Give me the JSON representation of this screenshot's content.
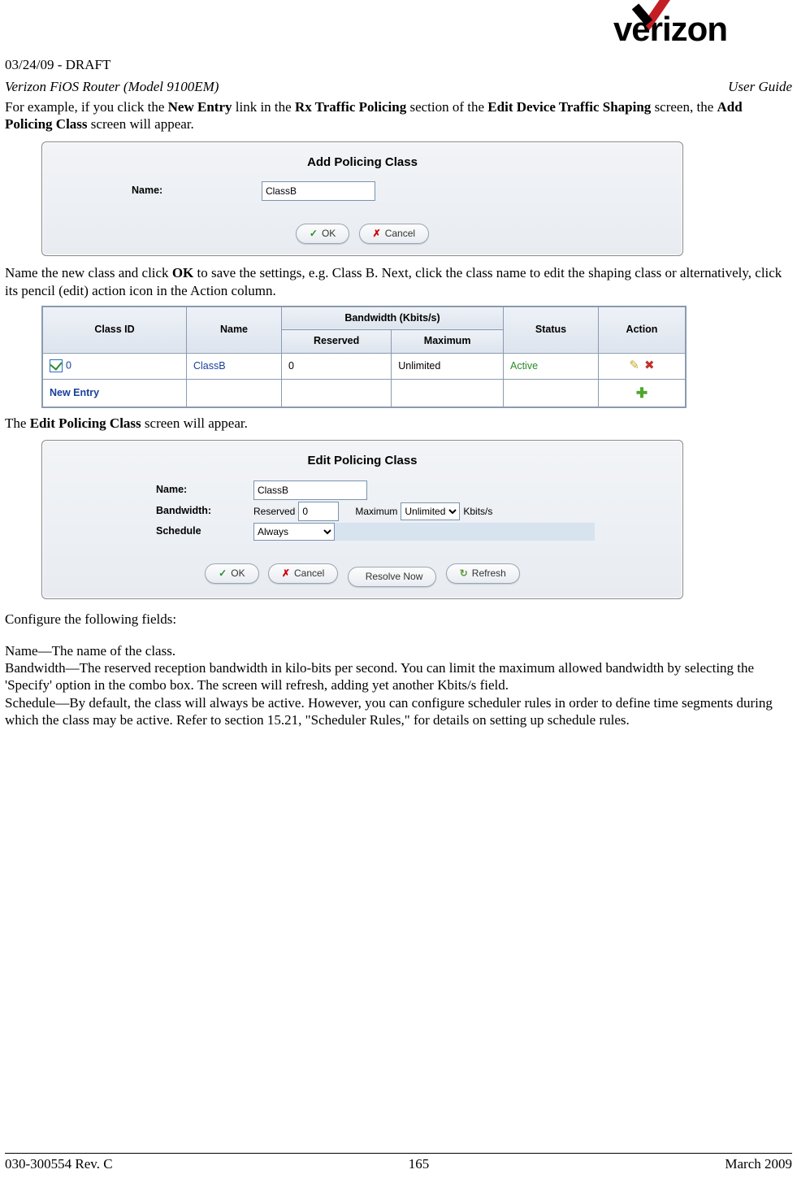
{
  "header": {
    "logo_text": "verizon",
    "draft_line": "03/24/09 - DRAFT",
    "product": "Verizon FiOS Router (Model 9100EM)",
    "doc_type": "User Guide"
  },
  "para1": {
    "pre": "For example, if you click the ",
    "b1": "New Entry",
    "m1": " link in the ",
    "b2": "Rx Traffic Policing",
    "m2": " section of the ",
    "b3": "Edit Device Traffic Shaping",
    "m3": " screen, the ",
    "b4": "Add Policing Class",
    "post": " screen will appear."
  },
  "add_panel": {
    "title": "Add Policing Class",
    "name_label": "Name:",
    "name_value": "ClassB",
    "ok": "OK",
    "cancel": "Cancel"
  },
  "para2": {
    "pre": "Name the new class and click ",
    "b1": "OK",
    "post": " to save the settings, e.g. Class B. Next, click the class name to edit the shaping class or alternatively, click its pencil (edit) action icon in the Action column."
  },
  "table": {
    "h_classid": "Class ID",
    "h_name": "Name",
    "h_bw": "Bandwidth (Kbits/s)",
    "h_reserved": "Reserved",
    "h_max": "Maximum",
    "h_status": "Status",
    "h_action": "Action",
    "row": {
      "id": "0",
      "name": "ClassB",
      "reserved": "0",
      "max": "Unlimited",
      "status": "Active"
    },
    "new_entry": "New Entry"
  },
  "para3": {
    "pre": "The ",
    "b1": "Edit Policing Class",
    "post": " screen will appear."
  },
  "edit_panel": {
    "title": "Edit Policing Class",
    "name_label": "Name:",
    "name_value": "ClassB",
    "bw_label": "Bandwidth:",
    "reserved_text": "Reserved",
    "reserved_value": "0",
    "max_text": "Maximum",
    "max_select": "Unlimited",
    "kbits": "Kbits/s",
    "sched_label": "Schedule",
    "sched_value": "Always",
    "ok": "OK",
    "cancel": "Cancel",
    "resolve": "Resolve Now",
    "refresh": "Refresh"
  },
  "para4": "Configure the following fields:",
  "defs": {
    "name_t": "Name",
    "name_d": "—The name of the class.",
    "bw_t": "Bandwidth",
    "bw_d": "—The reserved reception bandwidth in kilo-bits per second. You can limit the maximum allowed bandwidth by selecting the 'Specify' option in the combo box. The screen will refresh, adding yet another Kbits/s field.",
    "sc_t": "Schedule",
    "sc_d": "—By default, the class will always be active. However, you can configure scheduler rules in order to define time segments during which the class may be active. Refer to section 15.21, \"Scheduler Rules,\" for details on setting up schedule rules."
  },
  "footer": {
    "rev": "030-300554 Rev. C",
    "page": "165",
    "date": "March 2009"
  }
}
